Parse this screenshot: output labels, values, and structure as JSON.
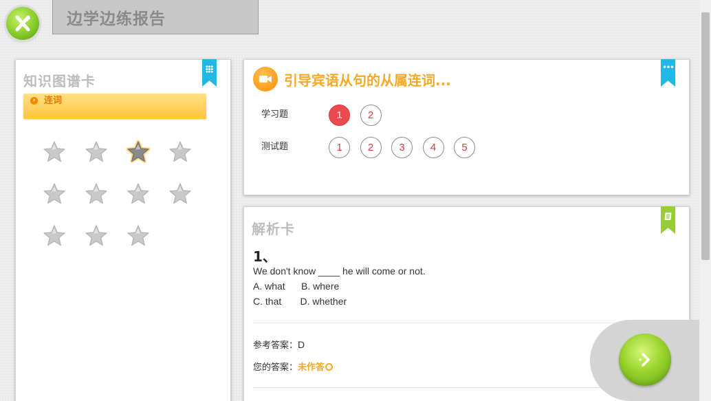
{
  "header": {
    "title": "边学边练报告",
    "logo_icon": "x-logo-icon"
  },
  "knowledge_card": {
    "title": "知识图谱卡",
    "topic_label": "连词",
    "stars": [
      {
        "state": "inactive"
      },
      {
        "state": "inactive"
      },
      {
        "state": "active"
      },
      {
        "state": "inactive"
      },
      {
        "state": "inactive"
      },
      {
        "state": "inactive"
      },
      {
        "state": "inactive"
      },
      {
        "state": "inactive"
      },
      {
        "state": "inactive"
      },
      {
        "state": "inactive"
      },
      {
        "state": "inactive"
      }
    ]
  },
  "question_card": {
    "title": "引导宾语从句的从属连词...",
    "study_label": "学习题",
    "study_items": [
      "1",
      "2"
    ],
    "study_active": "1",
    "test_label": "测试题",
    "test_items": [
      "1",
      "2",
      "3",
      "4",
      "5"
    ]
  },
  "analysis_card": {
    "title": "解析卡",
    "number": "1、",
    "question": "We don't know ____ he will come or not.",
    "options_line1": "A. what      B. where",
    "options_line2": "C. that       D. whether",
    "ref_answer_label": "参考答案：",
    "ref_answer_value": "D",
    "your_answer_label": "您的答案：",
    "your_answer_value": "未作答"
  },
  "colors": {
    "accent_orange": "#f7a825",
    "active_red": "#ec4a4f",
    "bookmark_blue": "#23b7e5",
    "bookmark_green": "#98cc3a",
    "green_button": "#9ad42e"
  }
}
